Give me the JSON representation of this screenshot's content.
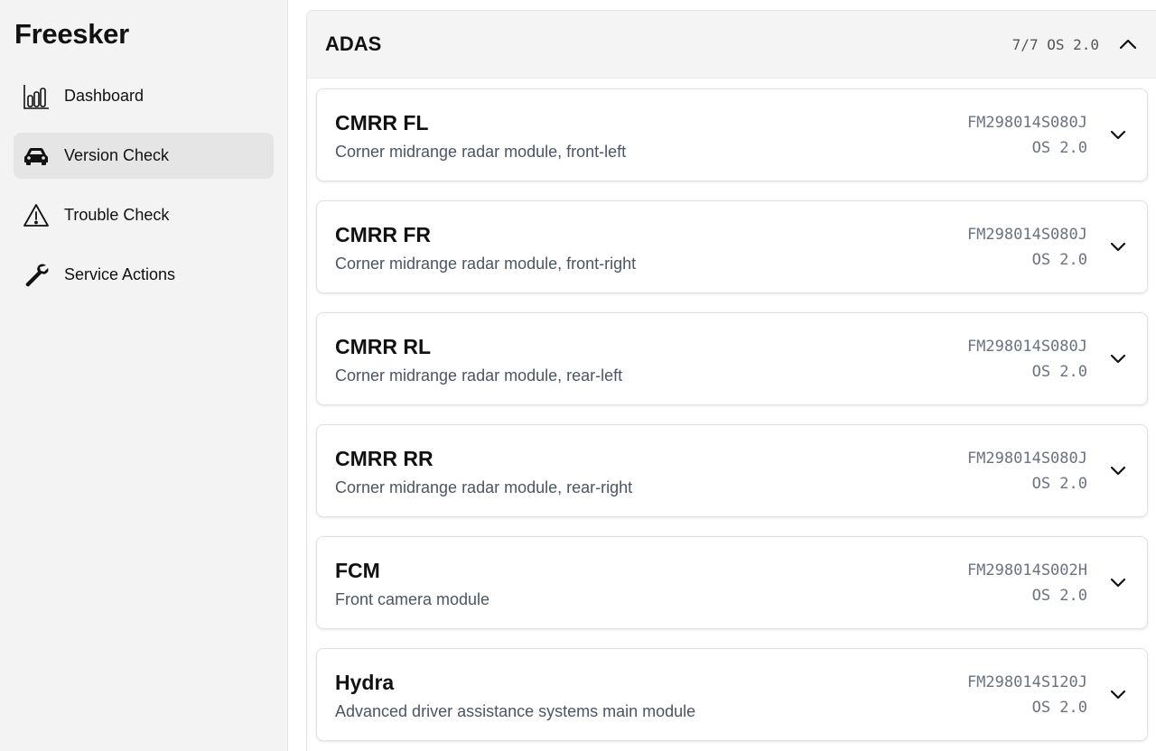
{
  "app": {
    "brand": "Freesker"
  },
  "sidebar": {
    "items": [
      {
        "label": "Dashboard",
        "icon": "bar-chart-icon",
        "active": false
      },
      {
        "label": "Version Check",
        "icon": "car-icon",
        "active": true
      },
      {
        "label": "Trouble Check",
        "icon": "warning-icon",
        "active": false
      },
      {
        "label": "Service Actions",
        "icon": "wrench-icon",
        "active": false
      }
    ]
  },
  "section": {
    "title": "ADAS",
    "meta": "7/7 OS 2.0",
    "expanded": true
  },
  "modules": [
    {
      "name": "CMRR FL",
      "description": "Corner midrange radar module, front-left",
      "part": "FM298014S080J",
      "os": "OS 2.0"
    },
    {
      "name": "CMRR FR",
      "description": "Corner midrange radar module, front-right",
      "part": "FM298014S080J",
      "os": "OS 2.0"
    },
    {
      "name": "CMRR RL",
      "description": "Corner midrange radar module, rear-left",
      "part": "FM298014S080J",
      "os": "OS 2.0"
    },
    {
      "name": "CMRR RR",
      "description": "Corner midrange radar module, rear-right",
      "part": "FM298014S080J",
      "os": "OS 2.0"
    },
    {
      "name": "FCM",
      "description": "Front camera module",
      "part": "FM298014S002H",
      "os": "OS 2.0"
    },
    {
      "name": "Hydra",
      "description": "Advanced driver assistance systems main module",
      "part": "FM298014S120J",
      "os": "OS 2.0"
    }
  ]
}
